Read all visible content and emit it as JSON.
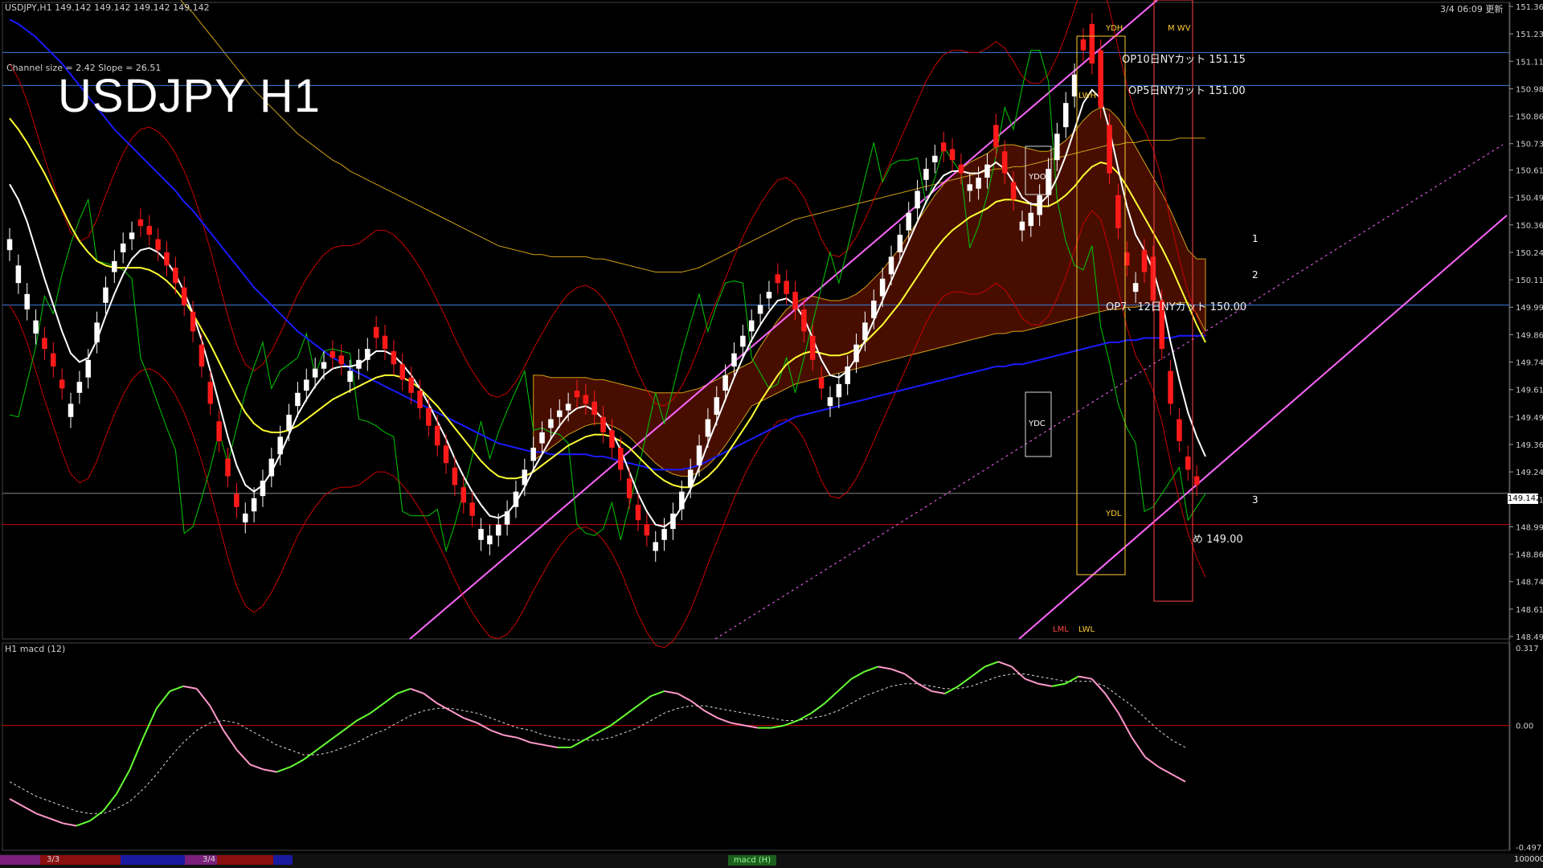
{
  "header": {
    "symbol_info": "USDJPY,H1  149.142 149.142 149.142 149.142",
    "channel_info": "Channel size = 2.42  Slope = 26.51",
    "big_title": "USDJPY H1",
    "datetime": "3/4 06:09 更新"
  },
  "current_price": "149.142",
  "macd_label": "H1  macd (12)",
  "colors": {
    "bull_candle": "#ffffff",
    "bear_candle": "#ff1a1a",
    "ma_fast": "#ffffff",
    "ma_mid": "#ffff33",
    "ma_slow": "#1a1aff",
    "bollinger": "#cc0000",
    "chikou": "#00cc00",
    "channel": "#ff66ff",
    "kumo": "#ff3300",
    "macd_up": "#66ff33",
    "macd_down": "#ff99cc",
    "hline": "#3a7bd5"
  },
  "levels": [
    {
      "text": "OP10日NYカット 151.15",
      "price": 151.15
    },
    {
      "text": "OP5日NYカット 151.00",
      "price": 151.0
    },
    {
      "text": "OP7、12日NYカット 150.00",
      "price": 150.0
    },
    {
      "text": "め 149.00",
      "price": 149.0
    }
  ],
  "markers": {
    "ydh": "YDH",
    "lwh": "LWH",
    "ydo": "YDO",
    "ydc": "YDC",
    "ydl": "YDL",
    "lml": "LML",
    "lwl": "LWL",
    "hw": "M WV",
    "n1": "1",
    "n2": "2",
    "n3": "3"
  },
  "footer": {
    "tab1": "3/3",
    "tab2": "3/4",
    "scroll": "macd (H)",
    "right": "100000"
  },
  "chart_data": [
    {
      "type": "candlestick",
      "title": "USDJPY H1",
      "ylim": [
        148.49,
        151.36
      ],
      "ytick_labels": [
        "151.360",
        "151.235",
        "151.110",
        "150.985",
        "150.860",
        "150.735",
        "150.615",
        "150.490",
        "150.365",
        "150.240",
        "150.115",
        "149.990",
        "149.865",
        "149.740",
        "149.615",
        "149.490",
        "149.365",
        "149.240",
        "149.115",
        "148.990",
        "148.865",
        "148.740",
        "148.615",
        "148.490"
      ],
      "close": [
        150.3,
        150.18,
        150.05,
        149.93,
        149.8,
        149.72,
        149.62,
        149.55,
        149.65,
        149.75,
        149.92,
        150.08,
        150.2,
        150.28,
        150.33,
        150.36,
        150.32,
        150.25,
        150.18,
        150.1,
        150.0,
        149.88,
        149.72,
        149.55,
        149.38,
        149.22,
        149.08,
        149.05,
        149.12,
        149.2,
        149.3,
        149.4,
        149.5,
        149.6,
        149.66,
        149.71,
        149.74,
        149.76,
        149.73,
        149.7,
        149.75,
        149.8,
        149.85,
        149.8,
        149.73,
        149.66,
        149.6,
        149.53,
        149.45,
        149.36,
        149.28,
        149.18,
        149.1,
        149.04,
        148.98,
        148.95,
        149.0,
        149.06,
        149.15,
        149.25,
        149.35,
        149.42,
        149.48,
        149.52,
        149.55,
        149.58,
        149.55,
        149.5,
        149.42,
        149.35,
        149.25,
        149.12,
        149.02,
        148.95,
        148.92,
        148.98,
        149.05,
        149.15,
        149.25,
        149.36,
        149.48,
        149.58,
        149.68,
        149.78,
        149.86,
        149.93,
        150.0,
        150.06,
        150.1,
        150.05,
        149.98,
        149.88,
        149.75,
        149.62,
        149.58,
        149.64,
        149.72,
        149.82,
        149.92,
        150.02,
        150.12,
        150.22,
        150.32,
        150.42,
        150.52,
        150.62,
        150.68,
        150.7,
        150.66,
        150.6,
        150.55,
        150.58,
        150.64,
        150.72,
        150.6,
        150.48,
        150.38,
        150.42,
        150.5,
        150.62,
        150.78,
        150.92,
        151.05,
        151.16,
        151.1,
        150.9,
        150.6,
        150.35,
        150.18,
        150.1,
        150.15,
        150.02,
        149.8,
        149.55,
        149.38,
        149.25,
        149.18,
        149.14
      ],
      "open_offset": [
        -0.05,
        -0.08,
        -0.07,
        -0.06,
        0.05,
        0.06,
        0.04,
        -0.06,
        -0.05,
        -0.08,
        -0.09,
        -0.07,
        -0.05,
        -0.04,
        -0.03,
        0.03,
        0.04,
        0.05,
        0.06,
        0.07,
        0.08,
        0.09,
        0.1,
        0.1,
        0.09,
        0.08,
        0.06,
        -0.04,
        -0.06,
        -0.07,
        -0.08,
        -0.08,
        -0.07,
        -0.06,
        -0.05,
        -0.04,
        -0.03,
        0.03,
        0.04,
        -0.05,
        -0.04,
        -0.05,
        0.05,
        0.06,
        0.06,
        0.07,
        0.07,
        0.08,
        0.08,
        0.09,
        0.08,
        0.08,
        0.07,
        0.06,
        -0.05,
        -0.04,
        -0.05,
        -0.06,
        -0.07,
        -0.07,
        -0.06,
        -0.05,
        -0.04,
        -0.03,
        -0.03,
        0.03,
        0.04,
        0.06,
        0.07,
        0.08,
        0.1,
        0.09,
        0.07,
        0.05,
        -0.04,
        -0.05,
        -0.07,
        -0.08,
        -0.08,
        -0.09,
        -0.08,
        -0.08,
        -0.07,
        -0.06,
        -0.05,
        -0.05,
        -0.04,
        -0.03,
        0.04,
        0.06,
        0.08,
        0.1,
        0.11,
        0.05,
        -0.04,
        -0.06,
        -0.08,
        -0.08,
        -0.08,
        -0.08,
        -0.08,
        -0.08,
        -0.08,
        -0.08,
        -0.08,
        -0.05,
        -0.03,
        0.04,
        0.05,
        0.04,
        -0.03,
        -0.05,
        -0.06,
        0.1,
        0.1,
        0.08,
        -0.04,
        -0.06,
        -0.09,
        -0.12,
        -0.12,
        -0.11,
        -0.1,
        0.05,
        0.18,
        0.26,
        0.22,
        0.15,
        0.06,
        -0.04,
        0.1,
        0.2,
        0.22,
        0.15,
        0.1,
        0.06,
        0.04
      ],
      "ma_fast": [
        150.55,
        150.48,
        150.38,
        150.25,
        150.12,
        150.0,
        149.88,
        149.78,
        149.74,
        149.76,
        149.84,
        149.95,
        150.05,
        150.14,
        150.21,
        150.25,
        150.26,
        150.24,
        150.2,
        150.14,
        150.06,
        149.96,
        149.84,
        149.7,
        149.55,
        149.4,
        149.27,
        149.18,
        149.15,
        149.18,
        149.24,
        149.32,
        149.41,
        149.5,
        149.57,
        149.63,
        149.68,
        149.71,
        149.72,
        149.72,
        149.73,
        149.76,
        149.79,
        149.79,
        149.77,
        149.73,
        149.68,
        149.62,
        149.55,
        149.47,
        149.39,
        149.3,
        149.22,
        149.15,
        149.09,
        149.04,
        149.03,
        149.05,
        149.1,
        149.17,
        149.25,
        149.32,
        149.39,
        149.45,
        149.5,
        149.53,
        149.54,
        149.52,
        149.48,
        149.42,
        149.34,
        149.24,
        149.14,
        149.06,
        149.0,
        148.99,
        149.02,
        149.08,
        149.16,
        149.26,
        149.37,
        149.47,
        149.57,
        149.67,
        149.76,
        149.84,
        149.91,
        149.97,
        150.02,
        150.03,
        150.0,
        149.94,
        149.85,
        149.75,
        149.68,
        149.67,
        149.7,
        149.76,
        149.84,
        149.93,
        150.02,
        150.11,
        150.2,
        150.29,
        150.38,
        150.47,
        150.54,
        150.59,
        150.61,
        150.61,
        150.6,
        150.6,
        150.62,
        150.65,
        150.62,
        150.56,
        150.49,
        150.46,
        150.46,
        150.5,
        150.58,
        150.68,
        150.8,
        150.92,
        150.98,
        150.94,
        150.8,
        150.62,
        150.45,
        150.32,
        150.25,
        150.16,
        150.02,
        149.83,
        149.66,
        149.51,
        149.4,
        149.31
      ],
      "ma_mid": [
        150.85,
        150.8,
        150.74,
        150.67,
        150.6,
        150.52,
        150.44,
        150.36,
        150.29,
        150.24,
        150.2,
        150.18,
        150.17,
        150.17,
        150.17,
        150.17,
        150.16,
        150.14,
        150.11,
        150.07,
        150.02,
        149.96,
        149.89,
        149.82,
        149.74,
        149.66,
        149.58,
        149.51,
        149.46,
        149.43,
        149.42,
        149.42,
        149.43,
        149.45,
        149.48,
        149.51,
        149.54,
        149.57,
        149.59,
        149.61,
        149.63,
        149.65,
        149.67,
        149.68,
        149.68,
        149.67,
        149.65,
        149.62,
        149.58,
        149.54,
        149.49,
        149.44,
        149.39,
        149.34,
        149.29,
        149.25,
        149.22,
        149.21,
        149.21,
        149.22,
        149.24,
        149.27,
        149.3,
        149.33,
        149.36,
        149.38,
        149.4,
        149.41,
        149.41,
        149.4,
        149.38,
        149.35,
        149.31,
        149.27,
        149.23,
        149.2,
        149.18,
        149.17,
        149.17,
        149.19,
        149.22,
        149.26,
        149.31,
        149.37,
        149.43,
        149.49,
        149.56,
        149.62,
        149.68,
        149.73,
        149.76,
        149.78,
        149.79,
        149.78,
        149.77,
        149.77,
        149.78,
        149.8,
        149.83,
        149.87,
        149.91,
        149.96,
        150.01,
        150.07,
        150.13,
        150.19,
        150.25,
        150.3,
        150.34,
        150.37,
        150.4,
        150.42,
        150.44,
        150.47,
        150.48,
        150.48,
        150.47,
        150.46,
        150.45,
        150.45,
        150.47,
        150.5,
        150.54,
        150.59,
        150.63,
        150.65,
        150.64,
        150.6,
        150.54,
        150.47,
        150.4,
        150.33,
        150.26,
        150.18,
        150.09,
        150.0,
        149.91,
        149.83
      ],
      "ma_slow": [
        151.3,
        151.28,
        151.25,
        151.22,
        151.18,
        151.14,
        151.1,
        151.05,
        151.0,
        150.95,
        150.9,
        150.85,
        150.8,
        150.76,
        150.72,
        150.68,
        150.64,
        150.6,
        150.56,
        150.52,
        150.47,
        150.43,
        150.38,
        150.33,
        150.28,
        150.23,
        150.18,
        150.13,
        150.08,
        150.04,
        150.0,
        149.96,
        149.92,
        149.88,
        149.85,
        149.82,
        149.79,
        149.76,
        149.74,
        149.71,
        149.69,
        149.67,
        149.65,
        149.63,
        149.61,
        149.59,
        149.57,
        149.55,
        149.53,
        149.51,
        149.49,
        149.47,
        149.45,
        149.43,
        149.41,
        149.39,
        149.37,
        149.36,
        149.35,
        149.34,
        149.33,
        149.33,
        149.32,
        149.32,
        149.32,
        149.32,
        149.32,
        149.31,
        149.31,
        149.3,
        149.29,
        149.28,
        149.27,
        149.26,
        149.25,
        149.25,
        149.25,
        149.25,
        149.26,
        149.27,
        149.29,
        149.31,
        149.33,
        149.35,
        149.37,
        149.39,
        149.41,
        149.43,
        149.45,
        149.47,
        149.49,
        149.5,
        149.51,
        149.52,
        149.53,
        149.54,
        149.55,
        149.56,
        149.57,
        149.58,
        149.59,
        149.6,
        149.61,
        149.62,
        149.63,
        149.64,
        149.65,
        149.66,
        149.67,
        149.68,
        149.69,
        149.7,
        149.71,
        149.72,
        149.72,
        149.73,
        149.73,
        149.74,
        149.75,
        149.76,
        149.77,
        149.78,
        149.79,
        149.8,
        149.81,
        149.82,
        149.83,
        149.83,
        149.84,
        149.84,
        149.85,
        149.85,
        149.85,
        149.85,
        149.86,
        149.86,
        149.86,
        149.86
      ]
    },
    {
      "type": "line",
      "title": "H1  macd (12)",
      "ylim": [
        -0.497,
        0.317
      ],
      "ytick_labels": [
        "0.317",
        "0.00",
        "-0.497"
      ],
      "macd": [
        -0.3,
        -0.33,
        -0.36,
        -0.38,
        -0.4,
        -0.41,
        -0.39,
        -0.35,
        -0.28,
        -0.18,
        -0.05,
        0.07,
        0.14,
        0.16,
        0.15,
        0.08,
        -0.02,
        -0.1,
        -0.16,
        -0.18,
        -0.19,
        -0.17,
        -0.14,
        -0.1,
        -0.06,
        -0.02,
        0.02,
        0.05,
        0.09,
        0.13,
        0.15,
        0.13,
        0.09,
        0.06,
        0.03,
        0.01,
        -0.02,
        -0.04,
        -0.05,
        -0.07,
        -0.08,
        -0.09,
        -0.09,
        -0.06,
        -0.03,
        0.0,
        0.04,
        0.08,
        0.12,
        0.14,
        0.13,
        0.1,
        0.06,
        0.03,
        0.01,
        0.0,
        -0.01,
        -0.01,
        0.0,
        0.02,
        0.05,
        0.09,
        0.14,
        0.19,
        0.22,
        0.24,
        0.23,
        0.21,
        0.17,
        0.14,
        0.13,
        0.16,
        0.2,
        0.24,
        0.26,
        0.24,
        0.19,
        0.17,
        0.16,
        0.17,
        0.2,
        0.19,
        0.13,
        0.05,
        -0.05,
        -0.13,
        -0.17,
        -0.2,
        -0.23
      ],
      "signal": [
        -0.23,
        -0.26,
        -0.29,
        -0.31,
        -0.33,
        -0.35,
        -0.36,
        -0.36,
        -0.34,
        -0.31,
        -0.26,
        -0.2,
        -0.13,
        -0.07,
        -0.02,
        0.01,
        0.02,
        0.01,
        -0.02,
        -0.05,
        -0.08,
        -0.1,
        -0.12,
        -0.12,
        -0.11,
        -0.09,
        -0.07,
        -0.04,
        -0.02,
        0.01,
        0.04,
        0.06,
        0.07,
        0.07,
        0.06,
        0.05,
        0.03,
        0.01,
        -0.01,
        -0.02,
        -0.04,
        -0.05,
        -0.06,
        -0.06,
        -0.06,
        -0.05,
        -0.03,
        -0.01,
        0.02,
        0.05,
        0.07,
        0.08,
        0.08,
        0.07,
        0.06,
        0.05,
        0.04,
        0.03,
        0.02,
        0.02,
        0.03,
        0.04,
        0.06,
        0.09,
        0.12,
        0.14,
        0.16,
        0.17,
        0.17,
        0.16,
        0.15,
        0.15,
        0.16,
        0.18,
        0.2,
        0.21,
        0.21,
        0.2,
        0.19,
        0.18,
        0.18,
        0.18,
        0.16,
        0.12,
        0.08,
        0.03,
        -0.02,
        -0.06,
        -0.09
      ]
    }
  ]
}
